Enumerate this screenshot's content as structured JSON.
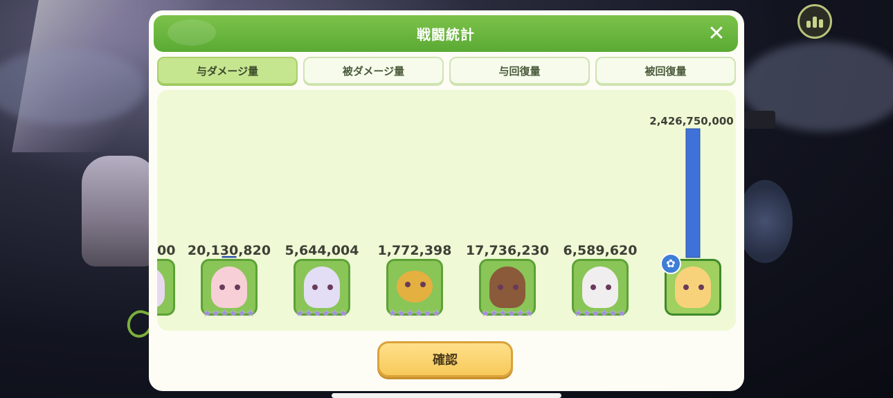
{
  "dialog": {
    "title": "戦闘統計",
    "close_icon": "close-icon",
    "confirm_label": "確認"
  },
  "tabs": [
    {
      "label": "与ダメージ量",
      "active": true
    },
    {
      "label": "被ダメージ量",
      "active": false
    },
    {
      "label": "与回復量",
      "active": false
    },
    {
      "label": "被回復量",
      "active": false
    }
  ],
  "chart_data": {
    "type": "bar",
    "series": [
      {
        "values": [
          20130820,
          5644004,
          1772398,
          17736230,
          6589620,
          2426750000
        ]
      }
    ],
    "value_labels": [
      "20,130,820",
      "5,644,004",
      "1,772,398",
      "17,736,230",
      "6,589,620",
      "2,426,750,000"
    ],
    "partial_first_label": "00",
    "bar_color": "#3f72d6",
    "ylim": [
      0,
      2426750000
    ]
  },
  "characters": [
    {
      "name_icon": "character-portrait-partial",
      "stars": 6
    },
    {
      "name_icon": "character-portrait-pink-hair",
      "stars": 6
    },
    {
      "name_icon": "character-portrait-lavender-hair",
      "stars": 6
    },
    {
      "name_icon": "character-portrait-bee-creature",
      "stars": 6
    },
    {
      "name_icon": "character-portrait-brown-hair",
      "stars": 6
    },
    {
      "name_icon": "character-portrait-white-hair",
      "stars": 6
    },
    {
      "name_icon": "character-portrait-blonde-hair",
      "stars": 0
    }
  ],
  "background": {
    "stats_button_icon": "bar-chart-icon"
  }
}
